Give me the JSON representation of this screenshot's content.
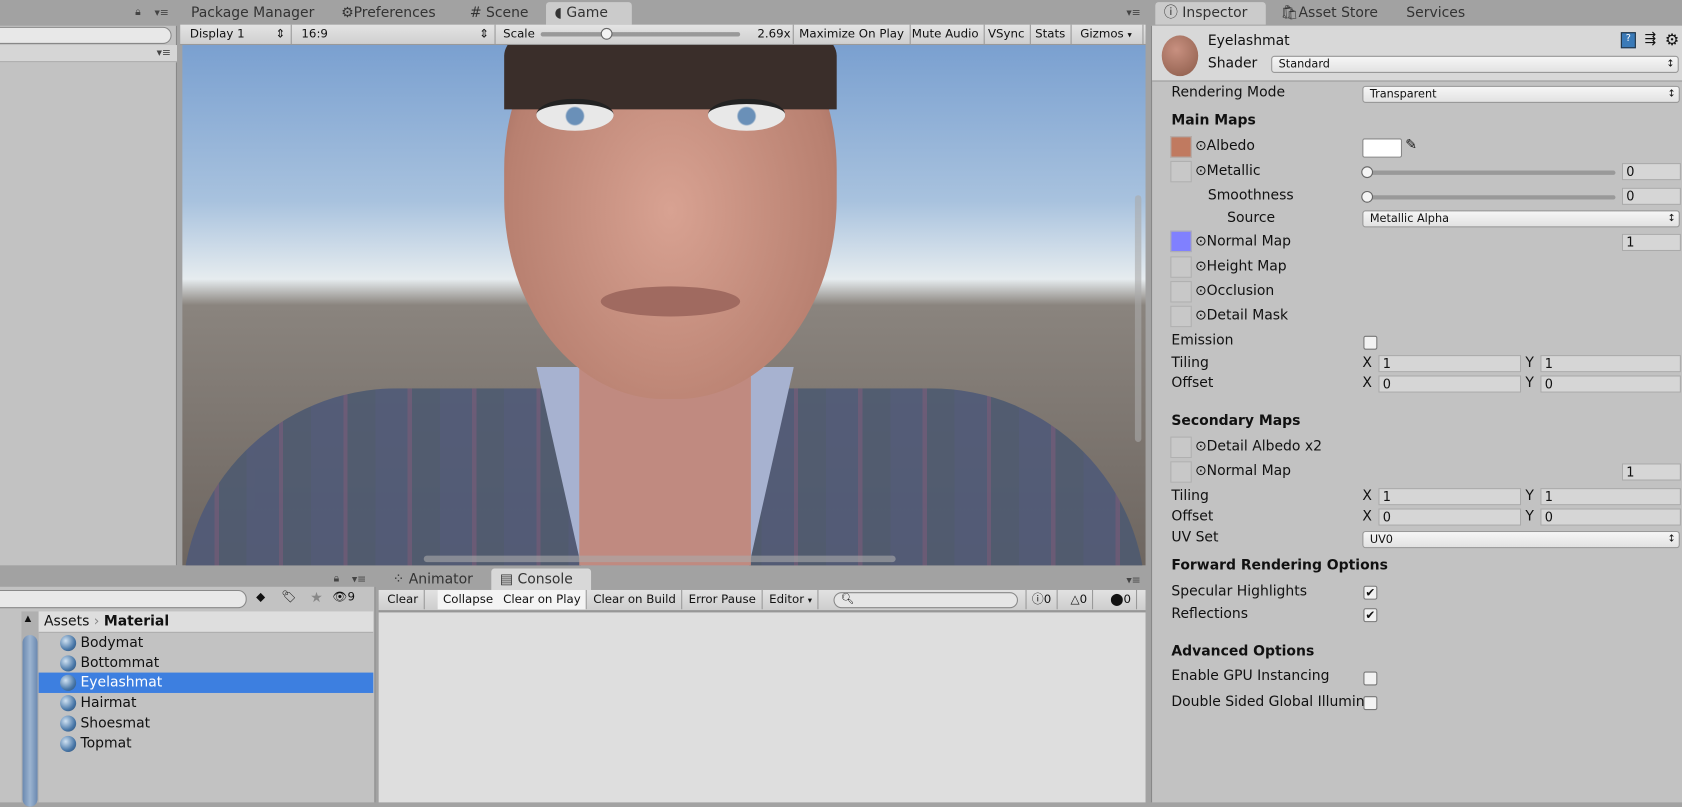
{
  "top_tabs": {
    "package_manager": "Package Manager",
    "preferences": "Preferences",
    "scene": "Scene",
    "game": "Game"
  },
  "game_toolbar": {
    "display": "Display 1",
    "aspect": "16:9",
    "scale_label": "Scale",
    "scale_value": "2.69x",
    "scale_fraction": 0.33,
    "maximize": "Maximize On Play",
    "mute": "Mute Audio",
    "vsync": "VSync",
    "stats": "Stats",
    "gizmos": "Gizmos"
  },
  "inspector_tabs": {
    "inspector": "Inspector",
    "asset_store": "Asset Store",
    "services": "Services"
  },
  "inspector": {
    "material_name": "Eyelashmat",
    "shader_label": "Shader",
    "shader_value": "Standard",
    "rendering_mode_label": "Rendering Mode",
    "rendering_mode_value": "Transparent",
    "main_maps": "Main Maps",
    "albedo": "Albedo",
    "albedo_color": "#ffffff",
    "metallic": "Metallic",
    "metallic_value": "0",
    "smoothness": "Smoothness",
    "smoothness_value": "0",
    "source": "Source",
    "source_value": "Metallic Alpha",
    "normal_map": "Normal Map",
    "normal_value": "1",
    "height_map": "Height Map",
    "occlusion": "Occlusion",
    "detail_mask": "Detail Mask",
    "emission": "Emission",
    "tiling": "Tiling",
    "offset": "Offset",
    "x": "X",
    "y": "Y",
    "tiling_x": "1",
    "tiling_y": "1",
    "offset_x": "0",
    "offset_y": "0",
    "secondary_maps": "Secondary Maps",
    "detail_albedo": "Detail Albedo x2",
    "normal_map2": "Normal Map",
    "normal_value2": "1",
    "tiling2_x": "1",
    "tiling2_y": "1",
    "offset2_x": "0",
    "offset2_y": "0",
    "uv_set": "UV Set",
    "uv_set_value": "UV0",
    "forward_rendering": "Forward Rendering Options",
    "specular": "Specular Highlights",
    "specular_checked": true,
    "reflections": "Reflections",
    "reflections_checked": true,
    "advanced": "Advanced Options",
    "gpu_instancing": "Enable GPU Instancing",
    "double_sided": "Double Sided Global Illumin"
  },
  "project": {
    "breadcrumb_root": "Assets",
    "breadcrumb_current": "Material",
    "hidden_count": "9",
    "assets": [
      {
        "name": "Bodymat"
      },
      {
        "name": "Bottommat"
      },
      {
        "name": "Eyelashmat",
        "selected": true
      },
      {
        "name": "Hairmat"
      },
      {
        "name": "Shoesmat"
      },
      {
        "name": "Topmat"
      }
    ]
  },
  "console_tabs": {
    "animator": "Animator",
    "console": "Console"
  },
  "console_toolbar": {
    "clear": "Clear",
    "collapse": "Collapse",
    "clear_on_play": "Clear on Play",
    "clear_on_build": "Clear on Build",
    "error_pause": "Error Pause",
    "editor": "Editor",
    "search_placeholder": "",
    "info_count": "0",
    "warning_count": "0",
    "error_count": "0"
  },
  "colors": {
    "selection": "#3d7fe0",
    "panel": "#c2c2c2",
    "tab_bar": "#a2a2a2"
  }
}
